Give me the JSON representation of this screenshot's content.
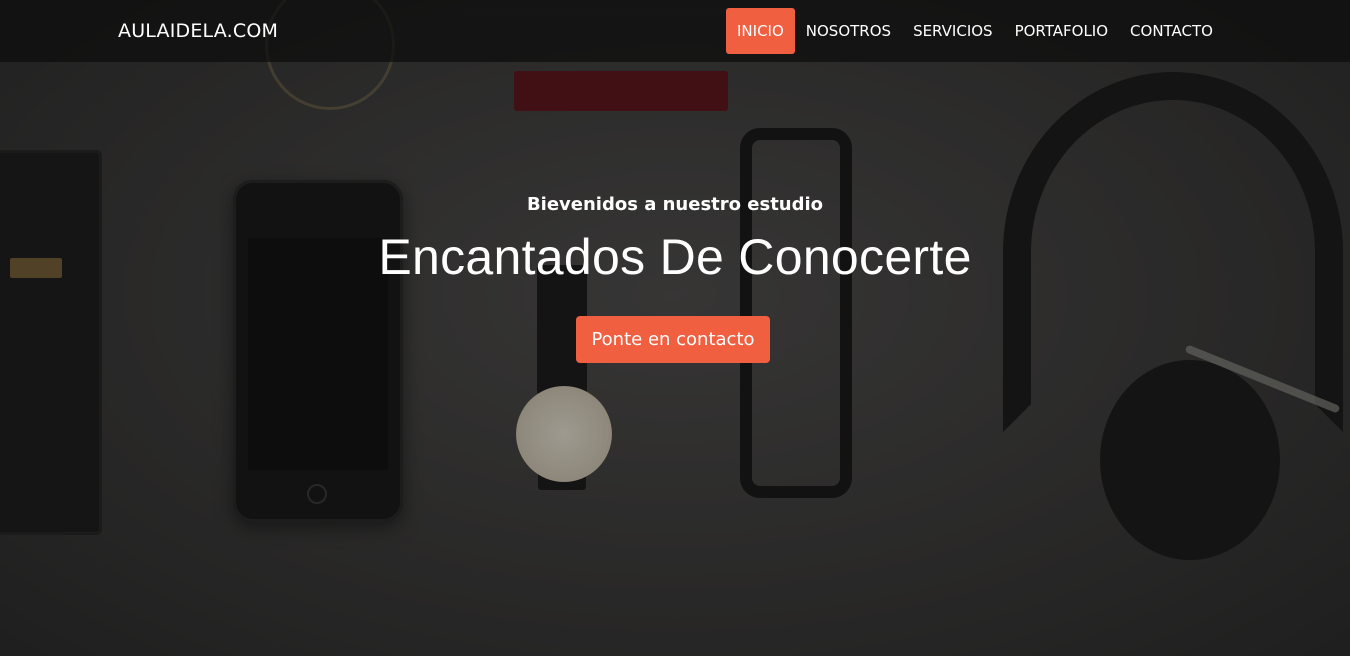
{
  "navbar": {
    "brand": "AULAIDELA.COM",
    "items": [
      {
        "label": "INICIO",
        "active": true
      },
      {
        "label": "NOSOTROS",
        "active": false
      },
      {
        "label": "SERVICIOS",
        "active": false
      },
      {
        "label": "PORTAFOLIO",
        "active": false
      },
      {
        "label": "CONTACTO",
        "active": false
      }
    ]
  },
  "hero": {
    "subtitle": "Bievenidos a nuestro estudio",
    "headline": "Encantados De Conocerte",
    "cta_label": "Ponte en contacto"
  },
  "colors": {
    "accent": "#f05f40",
    "navbar_bg": "#0c0c0c",
    "text": "#ffffff"
  }
}
